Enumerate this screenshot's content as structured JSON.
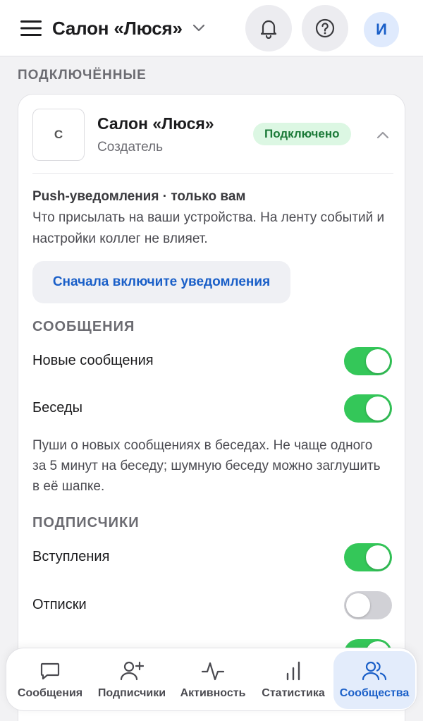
{
  "header": {
    "title": "Салон «Люся»",
    "avatar_letter": "И"
  },
  "section_label": "ПОДКЛЮЧЁННЫЕ",
  "community": {
    "logo_letter": "С",
    "name": "Салон «Люся»",
    "role": "Создатель",
    "status": "Подключено"
  },
  "push": {
    "title": "Push-уведомления · только вам",
    "description": "Что присылать на ваши устройства. На ленту событий и настройки коллег не влияет.",
    "enable_button": "Сначала включите уведомления"
  },
  "groups": {
    "messages": {
      "label": "СООБЩЕНИЯ",
      "items": [
        {
          "label": "Новые сообщения",
          "on": true
        },
        {
          "label": "Беседы",
          "on": true
        }
      ],
      "note": "Пуши о новых сообщениях в беседах. Не чаще одного за 5 минут на беседу; шумную беседу можно заглушить в её шапке."
    },
    "subscribers": {
      "label": "ПОДПИСЧИКИ",
      "items": [
        {
          "label": "Вступления",
          "on": true
        },
        {
          "label": "Отписки",
          "on": false
        }
      ]
    }
  },
  "tabs": [
    {
      "label": "Сообщения",
      "icon": "chat-bubble-icon",
      "active": false
    },
    {
      "label": "Подписчики",
      "icon": "user-plus-icon",
      "active": false
    },
    {
      "label": "Активность",
      "icon": "activity-pulse-icon",
      "active": false
    },
    {
      "label": "Статистика",
      "icon": "bar-chart-icon",
      "active": false
    },
    {
      "label": "Сообщества",
      "icon": "users-group-icon",
      "active": true
    }
  ],
  "colors": {
    "accent": "#1a5fc8",
    "toggle_on": "#34c759",
    "toggle_off": "#d1d1d6",
    "badge_bg": "#dcf7e3",
    "badge_text": "#1b7a38"
  }
}
